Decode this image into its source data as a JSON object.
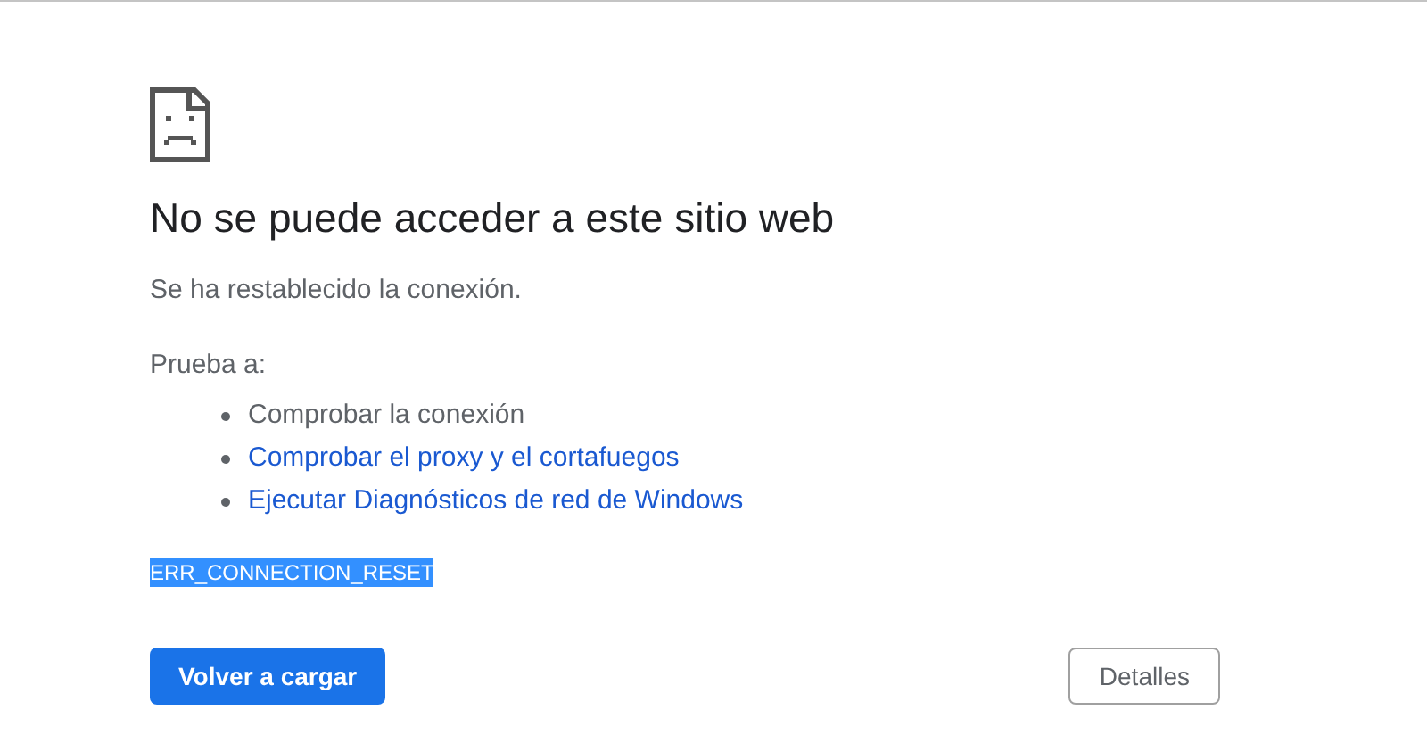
{
  "title": "No se puede acceder a este sitio web",
  "message": "Se ha restablecido la conexión.",
  "suggestions_heading": "Prueba a:",
  "suggestions": [
    {
      "kind": "text",
      "label": "Comprobar la conexión"
    },
    {
      "kind": "link",
      "label": "Comprobar el proxy y el cortafuegos"
    },
    {
      "kind": "link",
      "label": "Ejecutar Diagnósticos de red de Windows"
    }
  ],
  "error_code": {
    "text": "ERR_CONNECTION_RESET",
    "highlighted": true
  },
  "buttons": [
    {
      "kind": "primary",
      "label": "Volver a cargar"
    },
    {
      "kind": "secondary",
      "label": "Detalles"
    }
  ]
}
